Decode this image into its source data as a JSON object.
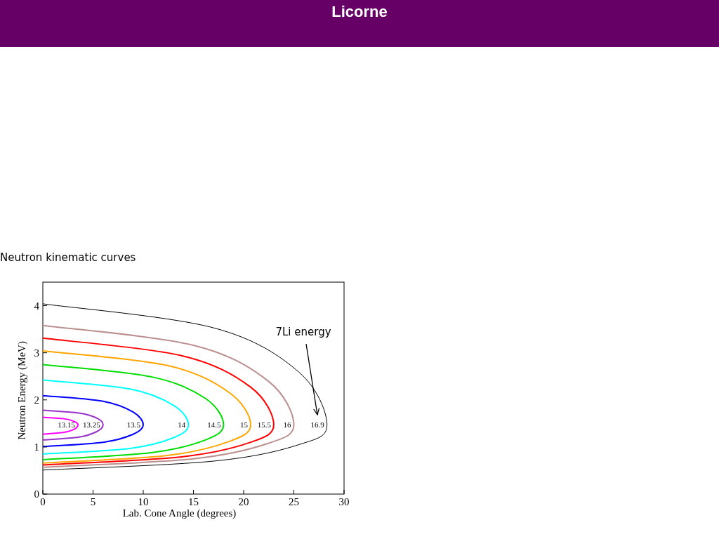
{
  "header": {
    "title": "Licorne"
  },
  "caption": "Neutron kinematic curves",
  "figure": {
    "chart_data": {
      "type": "line",
      "xlabel": "Lab. Cone Angle (degrees)",
      "ylabel": "Neutron Energy (MeV)",
      "xlim": [
        0,
        30
      ],
      "ylim": [
        0,
        4.5
      ],
      "xticks": [
        0,
        5,
        10,
        15,
        20,
        25,
        30
      ],
      "yticks": [
        0,
        1,
        2,
        3,
        4
      ],
      "series": [
        {
          "name": "13.15",
          "color": "#ff00ff",
          "x": [
            0,
            2.1,
            3.15,
            3.5,
            3.15,
            2.1,
            0
          ],
          "values": [
            1.63,
            1.6,
            1.54,
            1.47,
            1.38,
            1.31,
            1.27
          ]
        },
        {
          "name": "13.25",
          "color": "#9932cc",
          "x": [
            0,
            3.6,
            5.4,
            6,
            5.4,
            3.6,
            0
          ],
          "values": [
            1.78,
            1.72,
            1.61,
            1.47,
            1.33,
            1.21,
            1.15
          ]
        },
        {
          "name": "13.5",
          "color": "#0000ff",
          "x": [
            0,
            6,
            9,
            10,
            9,
            6,
            0
          ],
          "values": [
            2.09,
            1.97,
            1.74,
            1.47,
            1.27,
            1.1,
            1.01
          ]
        },
        {
          "name": "14",
          "color": "#00ffff",
          "x": [
            0,
            8.7,
            13.05,
            14.5,
            13.05,
            8.7,
            0
          ],
          "values": [
            2.42,
            2.23,
            1.88,
            1.47,
            1.2,
            0.97,
            0.85
          ]
        },
        {
          "name": "14.5",
          "color": "#00dd00",
          "x": [
            0,
            10.8,
            16.2,
            18,
            16.2,
            10.8,
            0
          ],
          "values": [
            2.75,
            2.49,
            2.03,
            1.47,
            1.15,
            0.88,
            0.73
          ]
        },
        {
          "name": "15",
          "color": "#ffa500",
          "x": [
            0,
            12.4,
            18.6,
            20.7,
            18.6,
            12.4,
            0
          ],
          "values": [
            3.04,
            2.73,
            2.15,
            1.47,
            1.12,
            0.82,
            0.66
          ]
        },
        {
          "name": "15.5",
          "color": "#ff0000",
          "x": [
            0,
            13.8,
            20.7,
            23,
            20.7,
            13.8,
            0
          ],
          "values": [
            3.31,
            2.94,
            2.27,
            1.47,
            1.1,
            0.79,
            0.62
          ]
        },
        {
          "name": "16",
          "color": "#bc8f8f",
          "x": [
            0,
            15,
            22.5,
            25,
            22.5,
            15,
            0
          ],
          "values": [
            3.58,
            3.16,
            2.39,
            1.47,
            1.08,
            0.75,
            0.57
          ]
        },
        {
          "name": "16.9",
          "color": "#000000",
          "x": [
            0,
            17,
            25.5,
            28.3,
            25.5,
            17,
            0
          ],
          "values": [
            4.04,
            3.53,
            2.59,
            1.47,
            1.05,
            0.7,
            0.51
          ]
        }
      ],
      "annotations": [
        "7Li energy"
      ]
    }
  }
}
